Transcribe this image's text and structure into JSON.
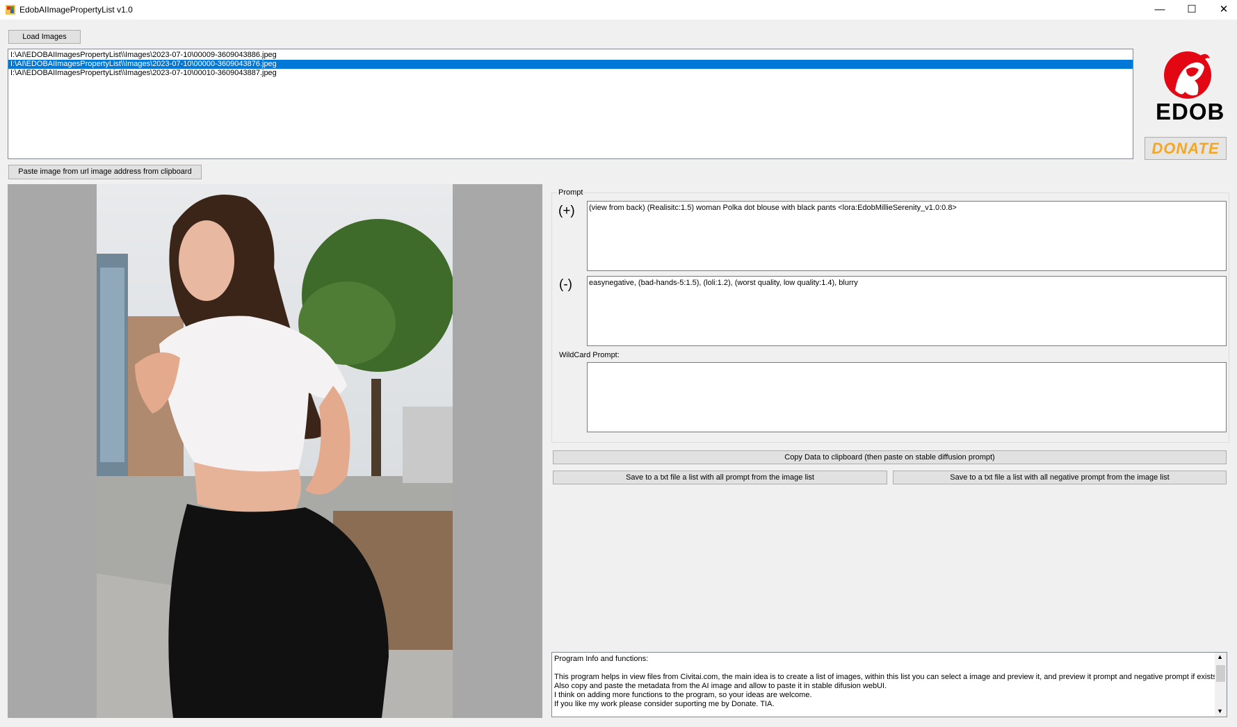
{
  "window": {
    "title": "EdobAIImagePropertyList v1.0",
    "controls": {
      "minimize": "—",
      "maximize": "☐",
      "close": "✕"
    }
  },
  "toolbar": {
    "load_images": "Load Images",
    "paste_url": "Paste image from url image address from clipboard"
  },
  "file_list": [
    "I:\\AI\\EDOBAIImagesPropertyList\\\\Images\\2023-07-10\\00009-3609043886.jpeg",
    "I:\\AI\\EDOBAIImagesPropertyList\\\\Images\\2023-07-10\\00000-3609043876.jpeg",
    "I:\\AI\\EDOBAIImagesPropertyList\\\\Images\\2023-07-10\\00010-3609043887.jpeg"
  ],
  "selected_index": 1,
  "logo": {
    "text": "EDOB",
    "color": "#e30613"
  },
  "donate_label": "DONATE",
  "prompt": {
    "group_label": "Prompt",
    "positive_symbol": "(+)",
    "positive_text": "(view from back) (Realisitc:1.5) woman Polka dot blouse with black pants <lora:EdobMillieSerenity_v1.0:0.8>",
    "negative_symbol": "(-)",
    "negative_text": "easynegative, (bad-hands-5:1.5), (loli:1.2), (worst quality, low quality:1.4), blurry",
    "wildcard_label": "WildCard Prompt:",
    "wildcard_text": ""
  },
  "actions": {
    "copy_clipboard": "Copy Data to clipboard (then paste on stable diffusion prompt)",
    "save_prompts": "Save to a txt file a list with all prompt from the image list",
    "save_negative": "Save to a txt file a list with all negative prompt from the image list"
  },
  "info": {
    "title": "Program Info and functions:",
    "lines": [
      "This program helps in view files from Civitai.com, the main idea is to create a list of images, within this list you can select a image and preview it, and preview it prompt and negative prompt if exists.",
      "Also copy and paste the metadata from the AI image and allow to paste it in stable difusion webUI.",
      "I think on adding more functions to the program, so your ideas are welcome.",
      "If you like my work please consider suporting me by Donate. TIA."
    ]
  },
  "colors": {
    "selection": "#0078d7",
    "window_bg": "#f0f0f0",
    "donate_text": "#f5a623"
  }
}
